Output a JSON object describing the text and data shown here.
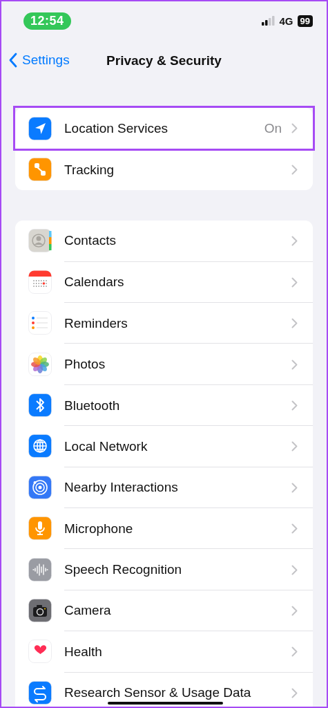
{
  "status_bar": {
    "time": "12:54",
    "network": "4G",
    "battery": "99"
  },
  "nav": {
    "back": "Settings",
    "title": "Privacy & Security"
  },
  "groups": [
    {
      "rows": [
        {
          "label": "Location Services",
          "value": "On",
          "highlighted": true
        },
        {
          "label": "Tracking",
          "highlighted": false
        }
      ]
    },
    {
      "rows": [
        {
          "label": "Contacts",
          "highlighted": false
        },
        {
          "label": "Calendars",
          "highlighted": false
        },
        {
          "label": "Reminders",
          "highlighted": false
        },
        {
          "label": "Photos",
          "highlighted": false
        },
        {
          "label": "Bluetooth",
          "highlighted": false
        },
        {
          "label": "Local Network",
          "highlighted": false
        },
        {
          "label": "Nearby Interactions",
          "highlighted": false
        },
        {
          "label": "Microphone",
          "highlighted": false
        },
        {
          "label": "Speech Recognition",
          "highlighted": false
        },
        {
          "label": "Camera",
          "highlighted": false
        },
        {
          "label": "Health",
          "highlighted": false
        },
        {
          "label": "Research Sensor & Usage Data",
          "highlighted": false
        }
      ]
    }
  ]
}
